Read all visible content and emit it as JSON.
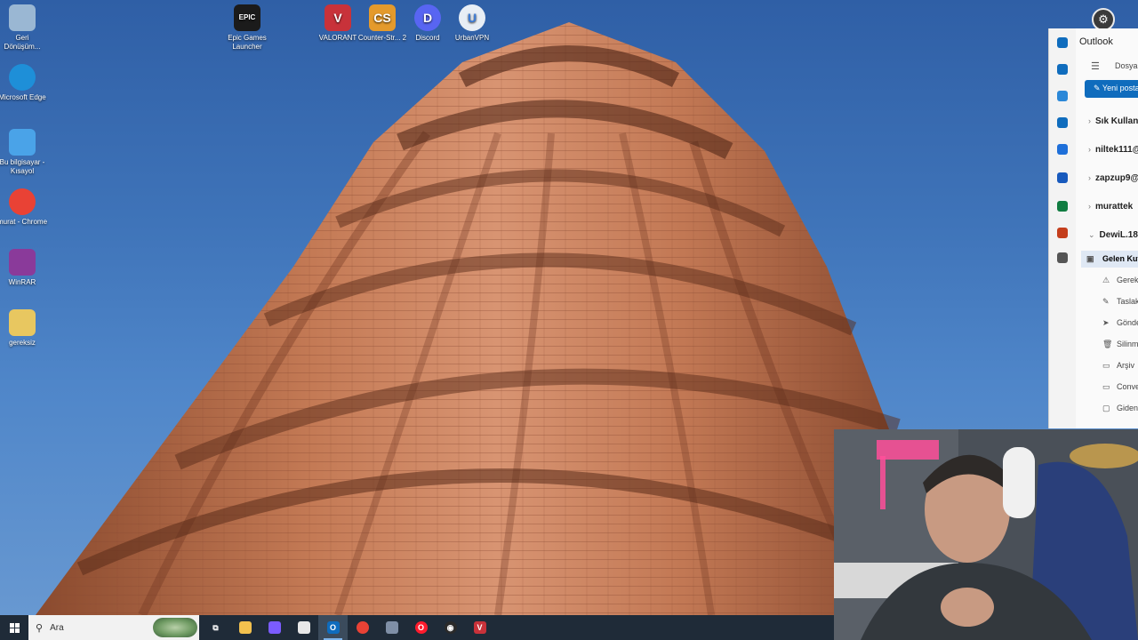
{
  "desktop": {
    "icons": [
      {
        "label": "Geri Dönüşüm...",
        "icon": "recycle-bin-icon",
        "color": "#9ab7d3"
      },
      {
        "label": "Microsoft Edge",
        "icon": "edge-icon",
        "color": "#1e8fd8"
      },
      {
        "label": "Bu bilgisayar - Kısayol",
        "icon": "this-pc-icon",
        "color": "#4aa3e8"
      },
      {
        "label": "murat - Chrome",
        "icon": "chrome-icon",
        "color": "#e94235"
      },
      {
        "label": "WinRAR",
        "icon": "winrar-icon",
        "color": "#8a3a9a"
      },
      {
        "label": "gereksiz",
        "icon": "folder-icon",
        "color": "#e8c760"
      },
      {
        "label": "Epic Games Launcher",
        "icon": "epic-games-icon",
        "color": "#1b1b1b",
        "glyph": "EPIC"
      },
      {
        "label": "VALORANT",
        "icon": "valorant-icon",
        "color": "#c8323a",
        "glyph": "V"
      },
      {
        "label": "Counter-Str... 2",
        "icon": "counter-strike-icon",
        "color": "#e49a2c",
        "glyph": "CS"
      },
      {
        "label": "Discord",
        "icon": "discord-icon",
        "color": "#5865f2",
        "glyph": "D"
      },
      {
        "label": "UrbanVPN",
        "icon": "urbanvpn-icon",
        "color": "#e8eef5",
        "glyph": "U"
      }
    ]
  },
  "outlook": {
    "title": "Outlook",
    "tab": "Dosya",
    "new_mail": "Yeni posta",
    "accounts": [
      "Sık Kullanılanlar",
      "niltek111@",
      "zapzup9@",
      "murattek",
      "DewiL.18"
    ],
    "folders": [
      "Gelen Kutusu",
      "Gereksiz",
      "Taslaklar",
      "Gönderilmiş",
      "Silinmiş",
      "Arşiv",
      "Conversation",
      "Giden Kutusu"
    ],
    "rail_colors": [
      "#0f6cbd",
      "#0f6cbd",
      "#2b88d8",
      "#0f6cbd",
      "#1e6fd9",
      "#185abd",
      "#107c41",
      "#c43e1c",
      "#555555"
    ]
  },
  "taskbar": {
    "search_placeholder": "Ara",
    "apps": [
      {
        "icon": "task-view-icon",
        "color": "#ffffff",
        "glyph": "⧉"
      },
      {
        "icon": "file-explorer-icon",
        "color": "#f2c14e",
        "glyph": ""
      },
      {
        "icon": "copilot-icon",
        "color": "#7b5cff",
        "glyph": ""
      },
      {
        "icon": "store-icon",
        "color": "#e8e8e8",
        "glyph": ""
      },
      {
        "icon": "outlook-icon",
        "color": "#0f6cbd",
        "glyph": "O",
        "active": true
      },
      {
        "icon": "chrome-icon",
        "color": "#e94235",
        "glyph": ""
      },
      {
        "icon": "calculator-icon",
        "color": "#7f8fa6",
        "glyph": ""
      },
      {
        "icon": "opera-icon",
        "color": "#ff1b2d",
        "glyph": "O"
      },
      {
        "icon": "obs-icon",
        "color": "#2a2a2a",
        "glyph": "◉"
      },
      {
        "icon": "valorant-icon",
        "color": "#c8323a",
        "glyph": "V"
      }
    ]
  }
}
